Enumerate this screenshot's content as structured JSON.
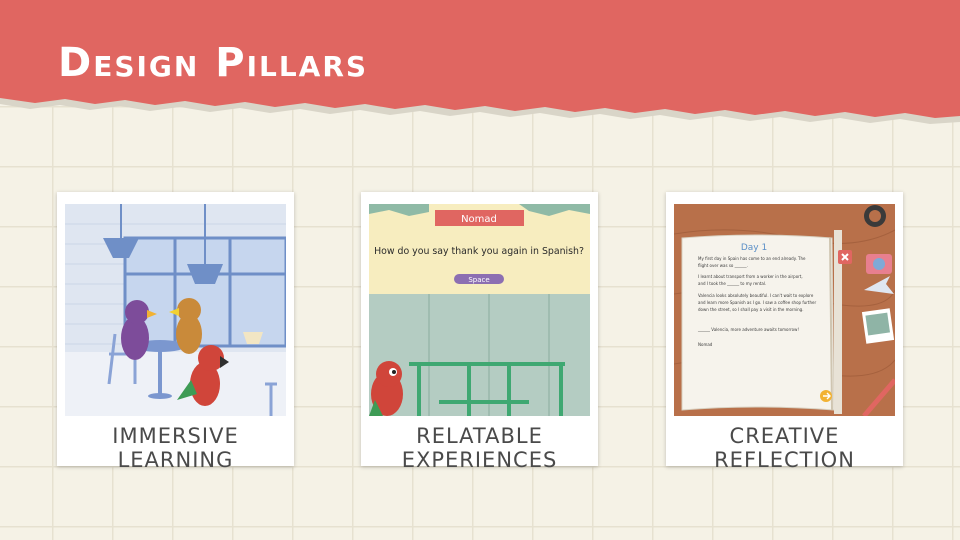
{
  "slide": {
    "title": "Design Pillars",
    "accent_color": "#e06661",
    "background_color": "#f5f2e6"
  },
  "pillars": [
    {
      "caption": "IMMERSIVE LEARNING"
    },
    {
      "caption": "RELATABLE EXPERIENCES",
      "game_screen": {
        "speaker_name": "Nomad",
        "question": "How do you say thank you again in Spanish?",
        "prompt_key": "Space"
      }
    },
    {
      "caption": "CREATIVE REFLECTION",
      "journal": {
        "heading": "Day 1",
        "lines": [
          "My first day in Spain has come to an end already. The",
          "flight over was so ______.",
          "I learnt about transport from a worker in the airport,",
          "and I took the ______ to my rental.",
          "Valencia looks absolutely beautiful. I can't wait to explore",
          "and learn more Spanish as I go. I saw a coffee shop further",
          "down the street, so I shall pay a visit in the morning.",
          "______ Valencia, more adventure awaits tomorrow!",
          "Nomad"
        ]
      }
    }
  ]
}
